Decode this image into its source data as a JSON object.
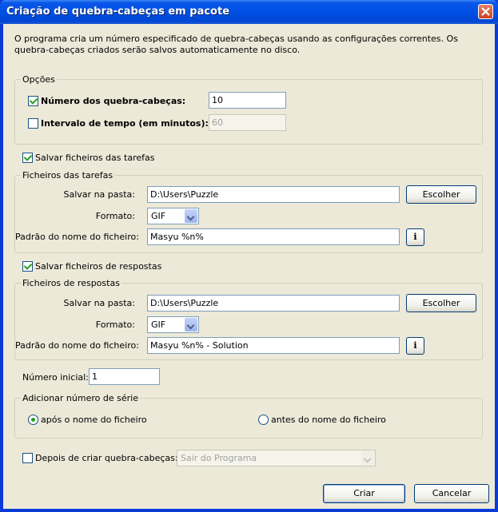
{
  "window": {
    "title": "Criação de quebra-cabeças em pacote"
  },
  "description": "O programa cria um número especificado de quebra-cabeças usando as configurações correntes. Os quebra-cabeças criados serão salvos automaticamente no disco.",
  "options": {
    "group_label": "Opções",
    "count_label": "Número dos quebra-cabeças:",
    "count_checked": true,
    "count_value": "10",
    "interval_label": "Intervalo de tempo (em minutos):",
    "interval_checked": false,
    "interval_value": "60"
  },
  "task_files": {
    "checkbox_label": "Salvar ficheiros das tarefas",
    "checked": true,
    "group_label": "Ficheiros das tarefas",
    "folder_label": "Salvar na pasta:",
    "folder_value": "D:\\Users\\Puzzle",
    "browse_label": "Escolher",
    "format_label": "Formato:",
    "format_value": "GIF",
    "pattern_label": "Padrão do nome do ficheiro:",
    "pattern_value": "Masyu %n%",
    "info_label": "i"
  },
  "solution_files": {
    "checkbox_label": "Salvar ficheiros de respostas",
    "checked": true,
    "group_label": "Ficheiros de respostas",
    "folder_label": "Salvar na pasta:",
    "folder_value": "D:\\Users\\Puzzle",
    "browse_label": "Escolher",
    "format_label": "Formato:",
    "format_value": "GIF",
    "pattern_label": "Padrão do nome do ficheiro:",
    "pattern_value": "Masyu %n% - Solution",
    "info_label": "i"
  },
  "start_number": {
    "label": "Número inicial:",
    "value": "1"
  },
  "serial": {
    "group_label": "Adicionar número de série",
    "after_label": "após o nome do ficheiro",
    "before_label": "antes do nome do ficheiro",
    "selected": "after"
  },
  "after_create": {
    "label": "Depois de criar quebra-cabeças:",
    "checked": false,
    "value": "Sair do Programa"
  },
  "buttons": {
    "create": "Criar",
    "cancel": "Cancelar"
  }
}
